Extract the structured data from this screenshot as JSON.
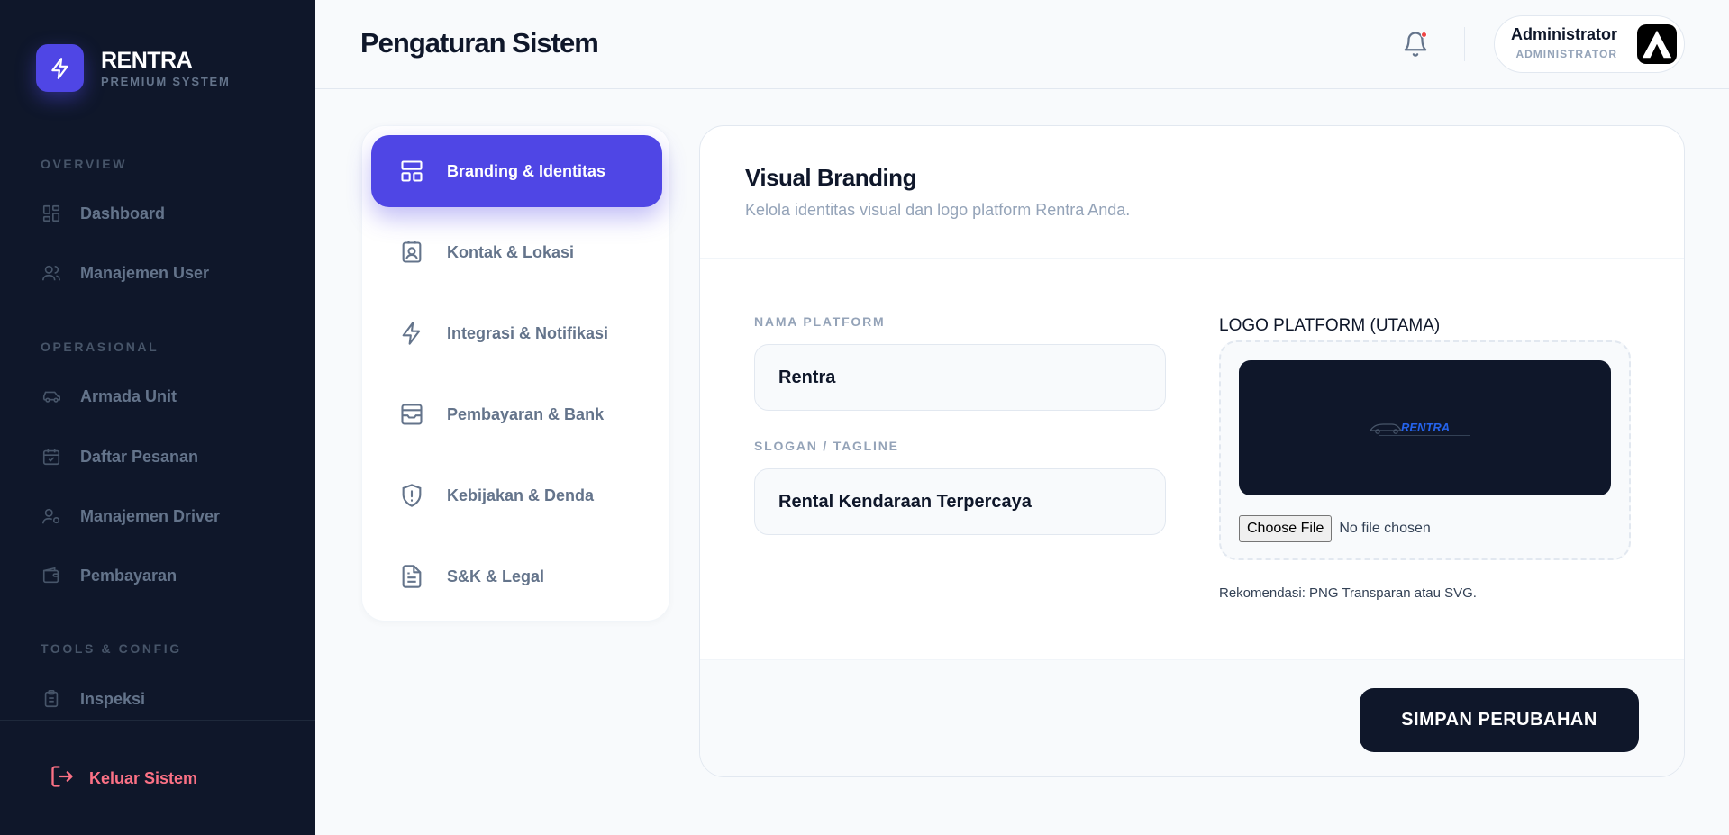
{
  "brand": {
    "name": "RENTRA",
    "subtitle": "PREMIUM SYSTEM"
  },
  "sidebar": {
    "sections": [
      {
        "title": "OVERVIEW"
      },
      {
        "title": "OPERASIONAL"
      },
      {
        "title": "TOOLS & CONFIG"
      }
    ],
    "items": [
      {
        "label": "Dashboard",
        "icon": "grid-icon"
      },
      {
        "label": "Manajemen User",
        "icon": "users-icon"
      },
      {
        "label": "Armada Unit",
        "icon": "car-icon"
      },
      {
        "label": "Daftar Pesanan",
        "icon": "calendar-check-icon"
      },
      {
        "label": "Manajemen Driver",
        "icon": "user-cog-icon"
      },
      {
        "label": "Pembayaran",
        "icon": "wallet-icon"
      },
      {
        "label": "Inspeksi",
        "icon": "clipboard-icon"
      }
    ],
    "logout_label": "Keluar Sistem"
  },
  "header": {
    "title": "Pengaturan Sistem",
    "user": {
      "name": "Administrator",
      "role": "ADMINISTRATOR"
    }
  },
  "settings_nav": {
    "items": [
      {
        "label": "Branding & Identitas",
        "icon": "layout-icon",
        "active": true
      },
      {
        "label": "Kontak & Lokasi",
        "icon": "contact-icon",
        "active": false
      },
      {
        "label": "Integrasi & Notifikasi",
        "icon": "bolt-icon",
        "active": false
      },
      {
        "label": "Pembayaran & Bank",
        "icon": "inbox-icon",
        "active": false
      },
      {
        "label": "Kebijakan & Denda",
        "icon": "shield-alert-icon",
        "active": false
      },
      {
        "label": "S&K & Legal",
        "icon": "document-icon",
        "active": false
      }
    ]
  },
  "main": {
    "title": "Visual Branding",
    "subtitle": "Kelola identitas visual dan logo platform Rentra Anda.",
    "platform_name": {
      "label": "NAMA PLATFORM",
      "value": "Rentra"
    },
    "slogan": {
      "label": "SLOGAN / TAGLINE",
      "value": "Rental Kendaraan Terpercaya"
    },
    "logo": {
      "label": "LOGO PLATFORM (UTAMA)",
      "preview_text": "RENTRA",
      "file_button": "Choose File",
      "file_status": "No file chosen",
      "hint": "Rekomendasi: PNG Transparan atau SVG."
    },
    "save_label": "SIMPAN PERUBAHAN"
  },
  "colors": {
    "sidebar_bg": "#0f172a",
    "accent": "#4f46e5",
    "logout": "#fb7185",
    "notification_dot": "#ef4444"
  }
}
